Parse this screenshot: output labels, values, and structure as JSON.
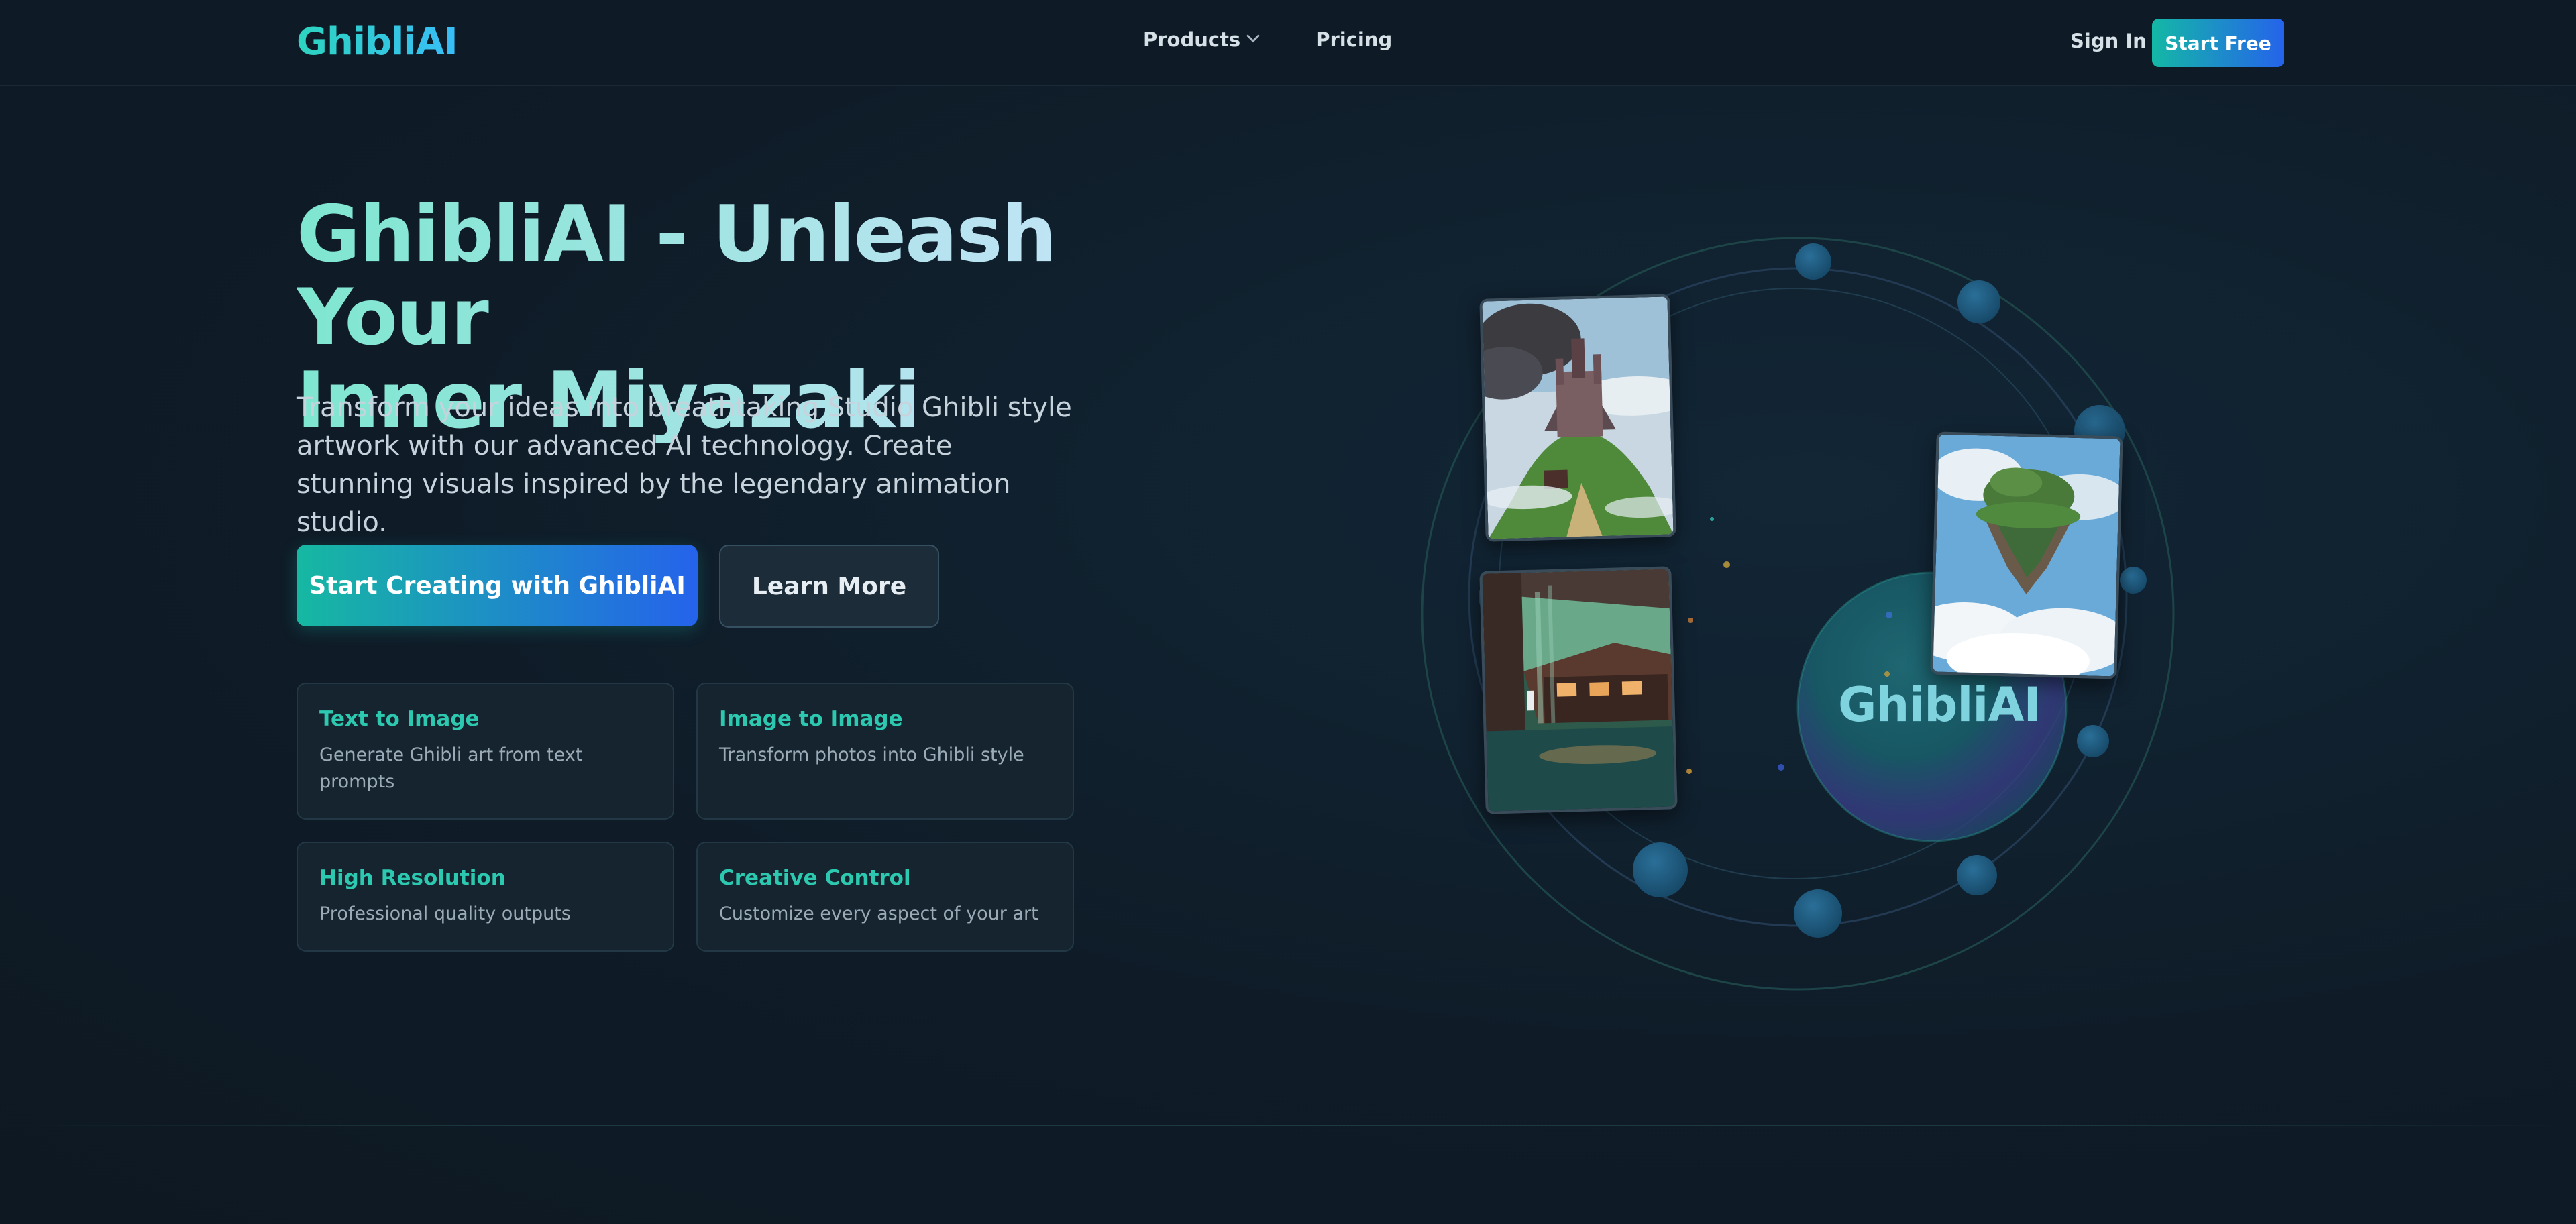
{
  "nav": {
    "logo": "GhibliAI",
    "items": [
      {
        "label": "Products",
        "has_dropdown": true
      },
      {
        "label": "Pricing",
        "has_dropdown": false
      }
    ],
    "signin": "Sign In",
    "cta": "Start Free"
  },
  "hero": {
    "title_line1": "GhibliAI - Unleash Your",
    "title_line2": "Inner Miyazaki",
    "subtitle": "Transform your ideas into breathtaking Studio Ghibli style artwork with our advanced AI technology. Create stunning visuals inspired by the legendary animation studio.",
    "primary_button": "Start Creating with GhibliAI",
    "secondary_button": "Learn More"
  },
  "features": [
    {
      "title": "Text to Image",
      "desc": "Generate Ghibli art from text prompts"
    },
    {
      "title": "Image to Image",
      "desc": "Transform photos into Ghibli style"
    },
    {
      "title": "High Resolution",
      "desc": "Professional quality outputs"
    },
    {
      "title": "Creative Control",
      "desc": "Customize every aspect of your art"
    }
  ],
  "visual": {
    "orb_label": "GhibliAI",
    "images": [
      "castle-illustration",
      "bathhouse-illustration",
      "floating-island-illustration"
    ]
  },
  "colors": {
    "background": "#0f1c28",
    "accent_teal": "#14b8a6",
    "accent_blue": "#2563eb",
    "feature_title": "#2cc9b0"
  }
}
